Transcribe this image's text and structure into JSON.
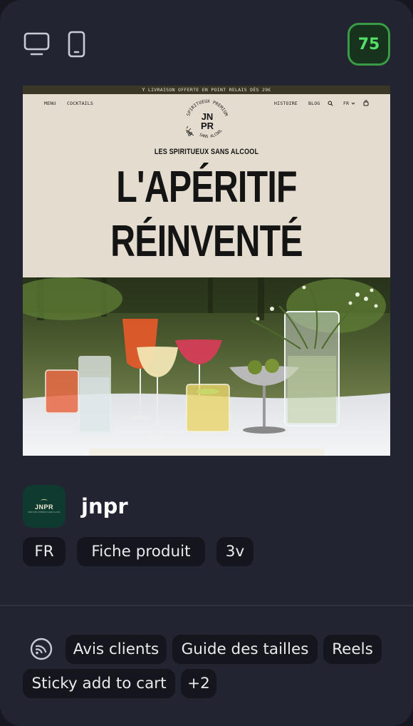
{
  "header": {
    "device_desktop_icon": "monitor-icon",
    "device_mobile_icon": "smartphone-icon",
    "score": "75",
    "score_color": "#55e06a"
  },
  "preview": {
    "promo_text": "LIVRAISON OFFERTE EN POINT RELAIS DÈS 29€",
    "nav_left": [
      "MENU",
      "COCKTAILS"
    ],
    "nav_right": [
      "HISTOIRE",
      "BLOG"
    ],
    "lang": "FR",
    "logo_text_top": "JN",
    "logo_text_bottom": "PR",
    "logo_ring_top": "SPIRITUEUX PREMIUM",
    "logo_ring_bottom": "SANS ALCOOL",
    "tagline": "LES SPIRITUEUX SANS ALCOOL",
    "hero_line_1": "L'APÉRITIF",
    "hero_line_2": "RÉINVENTÉ"
  },
  "brand": {
    "avatar_text": "JNPR",
    "avatar_subtext": "SPIRITUEUX PREMIUM SANS ALCOOL",
    "name": "jnpr",
    "avatar_bg": "#0f3a2f"
  },
  "tags": [
    "FR",
    "Fiche produit",
    "3v"
  ],
  "features": {
    "icon": "broadcast-icon",
    "items": [
      "Avis clients",
      "Guide des tailles",
      "Reels",
      "Sticky add to cart",
      "+2"
    ]
  }
}
